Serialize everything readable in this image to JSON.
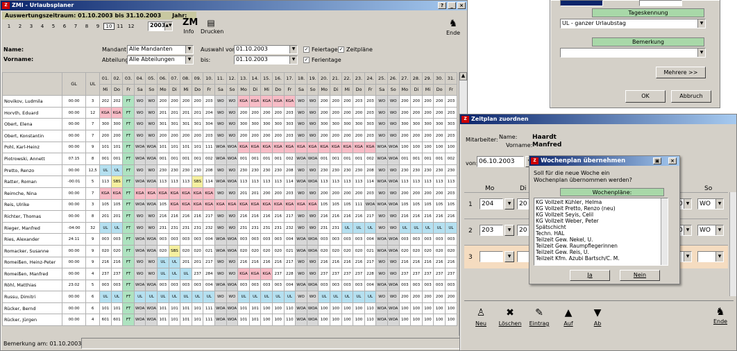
{
  "main": {
    "title": "ZMI - Urlaubsplaner",
    "period_label": "Auswertungszeitraum: 01.10.2003 bis 31.10.2003",
    "year_label": "Jahr:",
    "year_value": "2003",
    "months": [
      "1",
      "2",
      "3",
      "4",
      "5",
      "6",
      "7",
      "8",
      "9",
      "10",
      "11",
      "12"
    ],
    "active_month": "10",
    "info_label": "Info",
    "print_label": "Drucken",
    "end_label": "Ende",
    "name_label": "Name:",
    "vorname_label": "Vorname:",
    "mandant_label": "Mandant:",
    "mandant_value": "Alle Mandanten",
    "abteilung_label": "Abteilung:",
    "abteilung_value": "Alle Abteilungen",
    "auswahl_label": "Auswahl von:",
    "auswahl_from": "01.10.2003",
    "bis_label": "bis:",
    "auswahl_to": "01.10.2003",
    "feiertage_label": "Feiertage",
    "zeitplaene_label": "Zeitpläne",
    "ferientage_label": "Ferientage",
    "gl_header": "GL",
    "ul_header": "UL",
    "days": [
      [
        "01.",
        "Mi"
      ],
      [
        "02.",
        "Do"
      ],
      [
        "03.",
        "Fr"
      ],
      [
        "04.",
        "Sa"
      ],
      [
        "05.",
        "So"
      ],
      [
        "06.",
        "Mo"
      ],
      [
        "07.",
        "Di"
      ],
      [
        "08.",
        "Mi"
      ],
      [
        "09.",
        "Do"
      ],
      [
        "10.",
        "Fr"
      ],
      [
        "11.",
        "Sa"
      ],
      [
        "12.",
        "So"
      ],
      [
        "13.",
        "Mo"
      ],
      [
        "14.",
        "Di"
      ],
      [
        "15.",
        "Mi"
      ],
      [
        "16.",
        "Do"
      ],
      [
        "17.",
        "Fr"
      ],
      [
        "18.",
        "Sa"
      ],
      [
        "19.",
        "So"
      ],
      [
        "20.",
        "Mo"
      ],
      [
        "21.",
        "Di"
      ],
      [
        "22.",
        "Mi"
      ],
      [
        "23.",
        "Do"
      ],
      [
        "24.",
        "Fr"
      ],
      [
        "25.",
        "Sa"
      ],
      [
        "26.",
        "So"
      ],
      [
        "27.",
        "Mo"
      ],
      [
        "28.",
        "Di"
      ],
      [
        "29.",
        "Mi"
      ],
      [
        "30.",
        "Do"
      ],
      [
        "31.",
        "Fr"
      ]
    ],
    "employees": [
      {
        "name": "Novikov, Ludmila",
        "gl": "00:00",
        "ul": "3",
        "cells": [
          "202",
          "202",
          "FT",
          "WO",
          "WO",
          "200",
          "200",
          "200",
          "200",
          "203",
          "WO",
          "WO",
          "KGA",
          "KGA",
          "KGA",
          "KGA",
          "KGA",
          "WO",
          "WO",
          "200",
          "200",
          "200",
          "203",
          "203",
          "WO",
          "WO",
          "200",
          "200",
          "200",
          "200",
          "203"
        ]
      },
      {
        "name": "Horvth, Eduard",
        "gl": "00:00",
        "ul": "12",
        "cells": [
          "KGA",
          "KGA",
          "FT",
          "WO",
          "WO",
          "201",
          "201",
          "201",
          "201",
          "204",
          "WO",
          "WO",
          "200",
          "200",
          "200",
          "200",
          "203",
          "WO",
          "WO",
          "200",
          "200",
          "200",
          "200",
          "203",
          "WO",
          "WO",
          "200",
          "200",
          "200",
          "200",
          "203"
        ]
      },
      {
        "name": "Obert, Elena",
        "gl": "00:00",
        "ul": "7",
        "cells": [
          "300",
          "300",
          "FT",
          "WO",
          "WO",
          "301",
          "301",
          "301",
          "301",
          "304",
          "WO",
          "WO",
          "300",
          "300",
          "300",
          "300",
          "303",
          "WO",
          "WO",
          "300",
          "300",
          "300",
          "300",
          "303",
          "WO",
          "WO",
          "300",
          "300",
          "300",
          "300",
          "303"
        ]
      },
      {
        "name": "Obert, Konstantin",
        "gl": "00:00",
        "ul": "7",
        "cells": [
          "200",
          "200",
          "FT",
          "WO",
          "WO",
          "200",
          "200",
          "200",
          "200",
          "203",
          "WO",
          "WO",
          "200",
          "200",
          "200",
          "200",
          "203",
          "WO",
          "WO",
          "200",
          "200",
          "200",
          "200",
          "203",
          "WO",
          "WO",
          "200",
          "200",
          "200",
          "200",
          "203"
        ]
      },
      {
        "name": "Pohl, Karl-Heinz",
        "gl": "00:00",
        "ul": "9",
        "cells": [
          "101",
          "101",
          "FT",
          "WOA",
          "WOA",
          "101",
          "101",
          "101",
          "101",
          "111",
          "WOA",
          "WOA",
          "KGA",
          "KGA",
          "KGA",
          "KGA",
          "KGA",
          "KGA",
          "KGA",
          "KGA",
          "KGA",
          "KGA",
          "KGA",
          "KGA",
          "WOA",
          "WOA",
          "100",
          "100",
          "100",
          "100",
          "100"
        ]
      },
      {
        "name": "Piotrowski, Annett",
        "gl": "07:15",
        "ul": "8",
        "cells": [
          "001",
          "001",
          "FT",
          "WOA",
          "WOA",
          "001",
          "001",
          "001",
          "001",
          "002",
          "WOA",
          "WOA",
          "001",
          "001",
          "001",
          "001",
          "002",
          "WOA",
          "WOA",
          "001",
          "001",
          "001",
          "001",
          "002",
          "WOA",
          "WOA",
          "001",
          "001",
          "001",
          "001",
          "002"
        ]
      },
      {
        "name": "Pretto, Renzo",
        "gl": "00:00",
        "ul": "12,5",
        "cells": [
          "UL",
          "UL",
          "FT",
          "WO",
          "WO",
          "230",
          "230",
          "230",
          "230",
          "208",
          "WO",
          "WO",
          "230",
          "230",
          "230",
          "230",
          "208",
          "WO",
          "WO",
          "230",
          "230",
          "230",
          "230",
          "208",
          "WO",
          "WO",
          "230",
          "230",
          "230",
          "230",
          "230"
        ]
      },
      {
        "name": "Ratter, Roman",
        "gl": "-00:01",
        "ul": "5",
        "cells": [
          "113",
          "SBS",
          "FT",
          "WOA",
          "WOA",
          "113",
          "113",
          "113",
          "SBS",
          "114",
          "WOA",
          "WOA",
          "113",
          "113",
          "113",
          "113",
          "114",
          "WOA",
          "WOA",
          "113",
          "113",
          "113",
          "113",
          "114",
          "WOA",
          "WOA",
          "113",
          "113",
          "113",
          "113",
          "113"
        ]
      },
      {
        "name": "Reimche, Nina",
        "gl": "00:00",
        "ul": "7",
        "cells": [
          "KGA",
          "KGA",
          "FT",
          "KGA",
          "KGA",
          "KGA",
          "KGA",
          "KGA",
          "KGA",
          "KGA",
          "WO",
          "WO",
          "201",
          "201",
          "200",
          "200",
          "203",
          "WO",
          "WO",
          "200",
          "200",
          "200",
          "200",
          "203",
          "WO",
          "WO",
          "200",
          "200",
          "200",
          "200",
          "203"
        ]
      },
      {
        "name": "Reis, Ulrike",
        "gl": "00:00",
        "ul": "3",
        "cells": [
          "105",
          "105",
          "FT",
          "WOA",
          "WOA",
          "105",
          "KGA",
          "KGA",
          "KGA",
          "KGA",
          "KGA",
          "KGA",
          "KGA",
          "KGA",
          "KGA",
          "KGA",
          "KGA",
          "KGA",
          "KGA",
          "105",
          "105",
          "105",
          "111",
          "WOA",
          "WOA",
          "WOA",
          "105",
          "105",
          "105",
          "105",
          "105"
        ]
      },
      {
        "name": "Richter, Thomas",
        "gl": "00:00",
        "ul": "8",
        "cells": [
          "201",
          "201",
          "FT",
          "WO",
          "WO",
          "216",
          "216",
          "216",
          "216",
          "217",
          "WO",
          "WO",
          "216",
          "216",
          "216",
          "216",
          "217",
          "WO",
          "WO",
          "216",
          "216",
          "216",
          "216",
          "217",
          "WO",
          "WO",
          "216",
          "216",
          "216",
          "216",
          "216"
        ]
      },
      {
        "name": "Rieger, Manfred",
        "gl": "-04:00",
        "ul": "32",
        "cells": [
          "UL",
          "UL",
          "FT",
          "WO",
          "WO",
          "231",
          "231",
          "231",
          "231",
          "232",
          "WO",
          "WO",
          "231",
          "231",
          "231",
          "231",
          "232",
          "WO",
          "WO",
          "231",
          "231",
          "UL",
          "UL",
          "UL",
          "WO",
          "WO",
          "UL",
          "UL",
          "UL",
          "UL",
          "UL"
        ]
      },
      {
        "name": "Ries, Alexander",
        "gl": "24:11",
        "ul": "9",
        "cells": [
          "003",
          "003",
          "FT",
          "WOA",
          "WOA",
          "003",
          "003",
          "003",
          "003",
          "004",
          "WOA",
          "WOA",
          "003",
          "003",
          "003",
          "003",
          "004",
          "WOA",
          "WOA",
          "003",
          "003",
          "003",
          "003",
          "004",
          "WOA",
          "WOA",
          "003",
          "003",
          "003",
          "003",
          "003"
        ]
      },
      {
        "name": "Romacker, Susanne",
        "gl": "00:00",
        "ul": "9",
        "cells": [
          "020",
          "020",
          "FT",
          "WOA",
          "WOA",
          "020",
          "SBS",
          "020",
          "020",
          "021",
          "WOA",
          "WOA",
          "020",
          "020",
          "020",
          "020",
          "021",
          "WOA",
          "WOA",
          "020",
          "020",
          "020",
          "020",
          "021",
          "WOA",
          "WOA",
          "020",
          "020",
          "020",
          "020",
          "020"
        ]
      },
      {
        "name": "Romeißen, Heinz-Peter",
        "gl": "00:00",
        "ul": "9",
        "cells": [
          "216",
          "216",
          "FT",
          "WO",
          "WO",
          "UL",
          "UL",
          "201",
          "201",
          "217",
          "WO",
          "WO",
          "216",
          "216",
          "216",
          "216",
          "217",
          "WO",
          "WO",
          "216",
          "216",
          "216",
          "216",
          "217",
          "WO",
          "WO",
          "216",
          "216",
          "216",
          "216",
          "216"
        ]
      },
      {
        "name": "Romeißen, Manfred",
        "gl": "00:00",
        "ul": "4",
        "cells": [
          "237",
          "237",
          "FT",
          "WO",
          "WO",
          "UL",
          "UL",
          "UL",
          "237",
          "284",
          "WO",
          "WO",
          "KGA",
          "KGA",
          "KGA",
          "237",
          "228",
          "WO",
          "WO",
          "237",
          "237",
          "237",
          "237",
          "228",
          "WO",
          "WO",
          "237",
          "237",
          "237",
          "237",
          "237"
        ]
      },
      {
        "name": "Röhl, Matthias",
        "gl": "23:02",
        "ul": "5",
        "cells": [
          "003",
          "003",
          "FT",
          "WOA",
          "WOA",
          "003",
          "003",
          "003",
          "003",
          "004",
          "WOA",
          "WOA",
          "003",
          "003",
          "003",
          "003",
          "004",
          "WOA",
          "WOA",
          "003",
          "003",
          "003",
          "003",
          "004",
          "WOA",
          "WOA",
          "003",
          "003",
          "003",
          "003",
          "003"
        ]
      },
      {
        "name": "Russu, Dimitri",
        "gl": "00:00",
        "ul": "6",
        "cells": [
          "UL",
          "UL",
          "FT",
          "UL",
          "UL",
          "UL",
          "UL",
          "UL",
          "UL",
          "UL",
          "WO",
          "WO",
          "UL",
          "UL",
          "UL",
          "UL",
          "UL",
          "WO",
          "WO",
          "UL",
          "UL",
          "UL",
          "UL",
          "UL",
          "WO",
          "WO",
          "200",
          "200",
          "200",
          "200",
          "200"
        ]
      },
      {
        "name": "Rücker, Bernd",
        "gl": "00:00",
        "ul": "6",
        "cells": [
          "101",
          "101",
          "FT",
          "WOA",
          "WOA",
          "101",
          "101",
          "101",
          "101",
          "111",
          "WOA",
          "WOA",
          "101",
          "101",
          "100",
          "100",
          "110",
          "WOA",
          "WOA",
          "100",
          "100",
          "100",
          "100",
          "110",
          "WOA",
          "WOA",
          "100",
          "100",
          "100",
          "100",
          "100"
        ]
      },
      {
        "name": "Rücker, Jürgen",
        "gl": "00:00",
        "ul": "4",
        "cells": [
          "601",
          "601",
          "FT",
          "WOA",
          "WOA",
          "101",
          "101",
          "101",
          "101",
          "111",
          "WOA",
          "WOA",
          "101",
          "101",
          "100",
          "100",
          "110",
          "WOA",
          "WOA",
          "100",
          "100",
          "100",
          "100",
          "110",
          "WOA",
          "WOA",
          "100",
          "100",
          "100",
          "100",
          "100"
        ]
      }
    ],
    "remark_label": "Bemerkung am: 01.10.2003:"
  },
  "dlg1": {
    "tageskennung_label": "Tageskennung",
    "tageskennung_value": "UL - ganzer Urlaubstag",
    "bemerkung_label": "Bemerkung",
    "bemerkung_value": "",
    "mehrere_label": "Mehrere >>",
    "ok_label": "OK",
    "abbruch_label": "Abbruch"
  },
  "zp": {
    "title": "Zeitplan zuordnen",
    "mitarbeiter_label": "Mitarbeiter:",
    "name_label": "Name:",
    "name_value": "Haardt",
    "vorname_label": "Vorname:",
    "vorname_value": "Manfred",
    "von_label": "von:",
    "von_value": "06.10.2003",
    "col_mo": "Mo",
    "col_di": "Di",
    "col_so": "So",
    "rows": [
      {
        "num": "1",
        "mo": "204",
        "di": "20",
        "sa": "0",
        "so": "WO"
      },
      {
        "num": "2",
        "mo": "203",
        "di": "20",
        "sa": "0",
        "so": "WO"
      },
      {
        "num": "3",
        "mo": "",
        "di": "",
        "sa": "",
        "so": ""
      }
    ],
    "toolbar": [
      "Neu",
      "Löschen",
      "Eintrag",
      "Auf",
      "Ab"
    ],
    "end_label": "Ende"
  },
  "wp": {
    "title": "Wochenplan übernehmen",
    "question": "Soll für die neue Woche ein Wochenplan übernommen werden?",
    "list_header": "Wochenpläne:",
    "items": [
      "KG Vollzeit Kühler, Helma",
      "KG Vollzeit Pretto, Renzo (neu)",
      "KG Vollzeit Seyis, Celil",
      "KG Vollzeit Weber, Peter",
      "Spätschicht",
      "Techn. HAL",
      "Teilzeit Gew. Nekel, U.",
      "Teilzeit Gew. Raumpflegerinnen",
      "Teilzeit Gew. Reis, U.",
      "Teilzeit Kfm. Azubi Bartsch/C. M."
    ],
    "ja_label": "Ja",
    "nein_label": "Nein"
  }
}
